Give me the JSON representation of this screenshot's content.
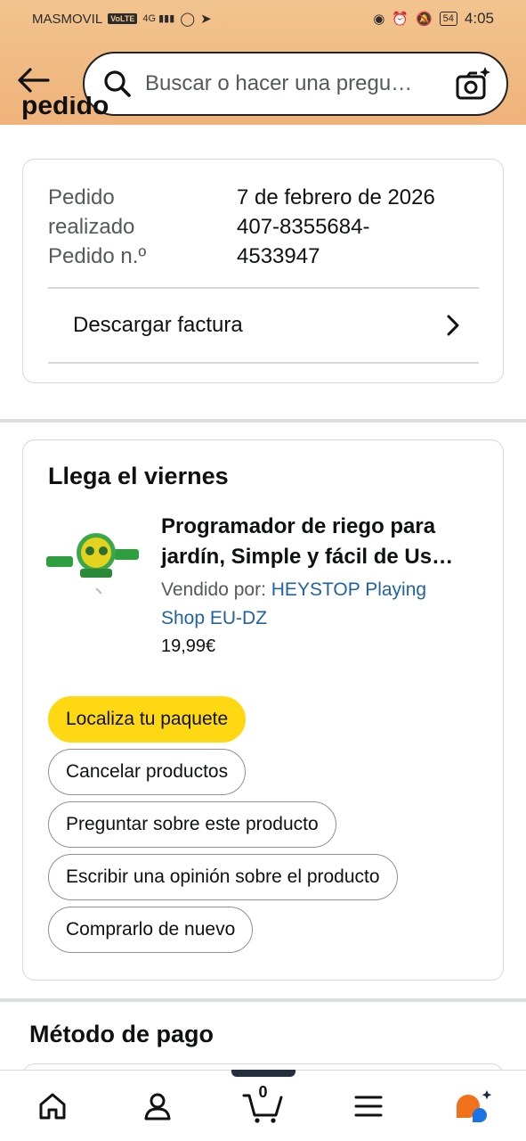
{
  "status_bar": {
    "carrier": "MASMOVIL",
    "volte": "VoLTE",
    "network": "4G",
    "battery": "54",
    "time": "4:05"
  },
  "header": {
    "search_placeholder": "Buscar o hacer una pregu…"
  },
  "page": {
    "title_partial": "pedido"
  },
  "order_info": {
    "label_lines": [
      "Pedido",
      "realizado",
      "Pedido n.º"
    ],
    "value_lines": [
      "7 de febrero de 2026",
      "407-8355684-",
      "4533947"
    ],
    "invoice_label": "Descargar factura"
  },
  "shipment": {
    "arrival": "Llega el viernes",
    "product_title_line1": "Programador de riego para",
    "product_title_line2": "jardín, Simple y fácil de Us…",
    "seller_prefix": "Vendido por: ",
    "seller_name_line1": "HEYSTOP Playing",
    "seller_name_line2": "Shop EU-DZ",
    "price": "19,99€",
    "buttons": {
      "track": "Localiza tu paquete",
      "cancel": "Cancelar productos",
      "ask": "Preguntar sobre este producto",
      "review": "Escribir una opinión sobre el producto",
      "buy_again": "Comprarlo de nuevo"
    }
  },
  "payment": {
    "title": "Método de pago"
  },
  "bottom_nav": {
    "items": [
      "home-icon",
      "account-icon",
      "cart-icon",
      "menu-icon",
      "rufus-icon"
    ],
    "cart_count": "0"
  },
  "colors": {
    "header_gradient_top": "#f2c48f",
    "header_gradient_bottom": "#efb27a",
    "primary_button": "#ffd814",
    "link": "#2162a1"
  }
}
